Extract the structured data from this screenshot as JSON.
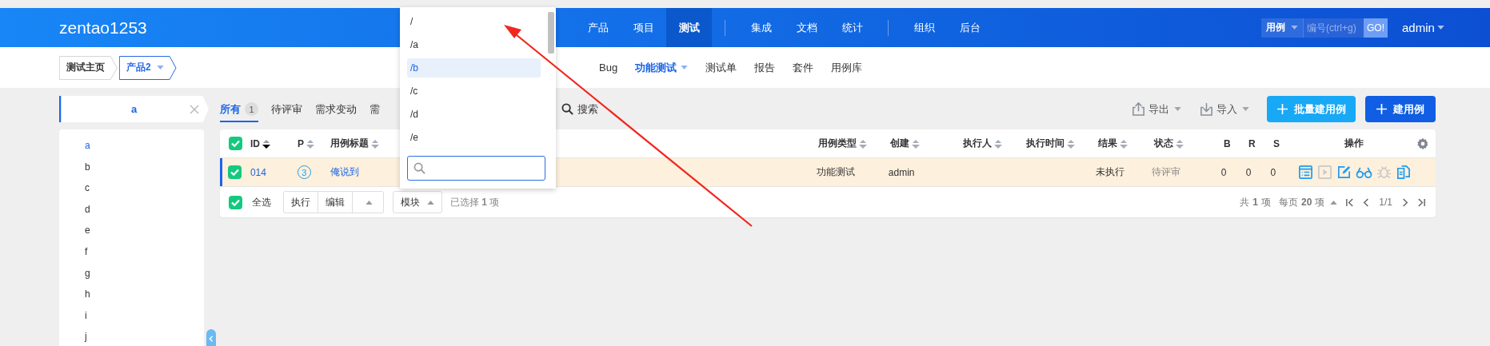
{
  "header": {
    "logo": "zentao1253",
    "nav_groups": [
      [
        {
          "label": "产品",
          "selected": false
        },
        {
          "label": "项目",
          "selected": false
        },
        {
          "label": "测试",
          "selected": true
        }
      ],
      [
        {
          "label": "集成",
          "selected": false
        },
        {
          "label": "文档",
          "selected": false
        },
        {
          "label": "统计",
          "selected": false
        }
      ],
      [
        {
          "label": "组织",
          "selected": false
        },
        {
          "label": "后台",
          "selected": false
        }
      ]
    ],
    "search": {
      "type": "用例",
      "placeholder": "编号(ctrl+g)",
      "button": "GO!"
    },
    "user": "admin"
  },
  "breadcrumb": [
    {
      "label": "测试主页",
      "selected": false,
      "dropdown": false
    },
    {
      "label": "产品2",
      "selected": true,
      "dropdown": true
    }
  ],
  "subnav": [
    {
      "label": "Bug",
      "selected": false,
      "dropdown": false
    },
    {
      "label": "功能测试",
      "selected": true,
      "dropdown": true
    },
    {
      "label": "测试单",
      "selected": false,
      "dropdown": false
    },
    {
      "label": "报告",
      "selected": false,
      "dropdown": false
    },
    {
      "label": "套件",
      "selected": false,
      "dropdown": false
    },
    {
      "label": "用例库",
      "selected": false,
      "dropdown": false
    }
  ],
  "module_filter": {
    "value": "a"
  },
  "tree": [
    {
      "label": "a",
      "selected": true
    },
    {
      "label": "b",
      "selected": false
    },
    {
      "label": "c",
      "selected": false
    },
    {
      "label": "d",
      "selected": false
    },
    {
      "label": "e",
      "selected": false
    },
    {
      "label": "f",
      "selected": false
    },
    {
      "label": "g",
      "selected": false
    },
    {
      "label": "h",
      "selected": false
    },
    {
      "label": "i",
      "selected": false
    },
    {
      "label": "j",
      "selected": false
    }
  ],
  "tabs": [
    {
      "label": "所有",
      "count": "1",
      "selected": true
    },
    {
      "label": "待评审",
      "selected": false
    },
    {
      "label": "需求变动",
      "selected": false
    },
    {
      "label": "需",
      "selected": false
    }
  ],
  "search_button": "搜索",
  "tools": [
    {
      "label": "导出",
      "kind": "export"
    },
    {
      "label": "导入",
      "kind": "import"
    }
  ],
  "buttons": [
    {
      "label": "批量建用例",
      "kind": "batch"
    },
    {
      "label": "建用例",
      "kind": "primary"
    }
  ],
  "table": {
    "checked": true,
    "columns": [
      {
        "label": "ID",
        "sortable": true,
        "sorted": true
      },
      {
        "label": "P",
        "sortable": true
      },
      {
        "label": "用例标题",
        "sortable": true
      },
      {
        "label": "用例类型",
        "sortable": true
      },
      {
        "label": "创建",
        "sortable": true
      },
      {
        "label": "执行人",
        "sortable": true
      },
      {
        "label": "执行时间",
        "sortable": true
      },
      {
        "label": "结果",
        "sortable": true
      },
      {
        "label": "状态",
        "sortable": true
      },
      {
        "label": "B",
        "sortable": false
      },
      {
        "label": "R",
        "sortable": false
      },
      {
        "label": "S",
        "sortable": false
      },
      {
        "label": "操作",
        "sortable": false
      }
    ],
    "rows": [
      {
        "checked": true,
        "selected": true,
        "id": "014",
        "priority": "3",
        "title": "俺说到",
        "type": "功能测试",
        "creator": "admin",
        "result": "未执行",
        "status": "待评审",
        "b": "0",
        "r": "0",
        "s": "0",
        "actions": [
          {
            "kind": "detail",
            "disabled": false
          },
          {
            "kind": "run",
            "disabled": true
          },
          {
            "kind": "edit",
            "disabled": false
          },
          {
            "kind": "review",
            "disabled": false
          },
          {
            "kind": "bug",
            "disabled": true
          },
          {
            "kind": "copy",
            "disabled": false
          }
        ]
      }
    ]
  },
  "footer": {
    "select_all": {
      "label": "全选",
      "checked": true
    },
    "batch_buttons": [
      "执行",
      "编辑"
    ],
    "module_button": "模块",
    "selection": "已选择 **1** 项",
    "total": "共 **1** 项",
    "per_page": "每页 **20** 项",
    "page": "1/1"
  },
  "dropdown": {
    "items": [
      {
        "label": "/",
        "selected": false
      },
      {
        "label": "/a",
        "selected": false
      },
      {
        "label": "/b",
        "selected": true
      },
      {
        "label": "/c",
        "selected": false
      },
      {
        "label": "/d",
        "selected": false
      },
      {
        "label": "/e",
        "selected": false
      }
    ]
  }
}
